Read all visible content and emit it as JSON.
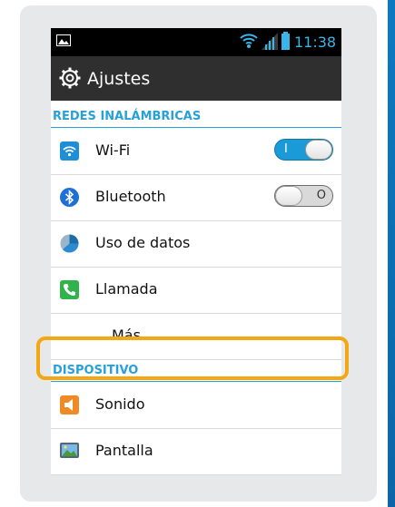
{
  "statusbar": {
    "time": "11:38",
    "icons": [
      "gallery-notification-icon",
      "wifi-signal-icon",
      "cell-signal-icon",
      "battery-icon"
    ]
  },
  "actionbar": {
    "title": "Ajustes",
    "icon": "settings-gear-icon"
  },
  "sections": [
    {
      "header": "REDES INALÁMBRICAS",
      "items": [
        {
          "label": "Wi-Fi",
          "icon": "wifi-icon",
          "toggle": {
            "state": "on",
            "mark": "I"
          }
        },
        {
          "label": "Bluetooth",
          "icon": "bluetooth-icon",
          "toggle": {
            "state": "off",
            "mark": "O"
          }
        },
        {
          "label": "Uso de datos",
          "icon": "data-usage-icon"
        },
        {
          "label": "Llamada",
          "icon": "phone-call-icon"
        },
        {
          "label": "Más ...",
          "icon": null,
          "highlighted": true
        }
      ]
    },
    {
      "header": "DISPOSITIVO",
      "items": [
        {
          "label": "Sonido",
          "icon": "sound-icon"
        },
        {
          "label": "Pantalla",
          "icon": "display-icon"
        }
      ]
    }
  ],
  "colors": {
    "accent": "#28a0d8",
    "highlight": "#f3a712",
    "toggle_on": "#1a9ad6",
    "actionbar": "#2f2f2f",
    "card": "#e7e8ea"
  }
}
